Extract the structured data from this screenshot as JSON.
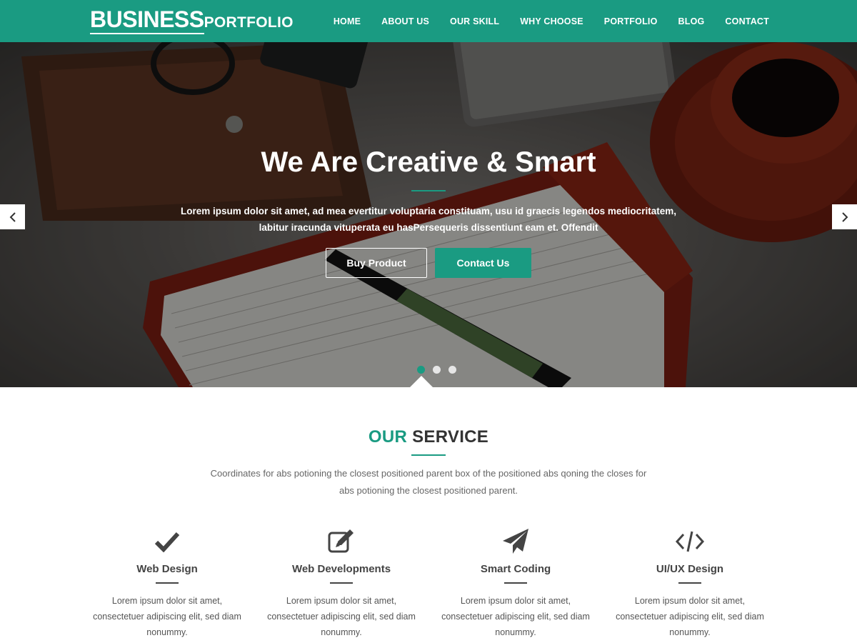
{
  "brand": {
    "main": "BUSINESS",
    "sub": "PORTFOLIO"
  },
  "nav": {
    "items": [
      "HOME",
      "ABOUT US",
      "OUR SKILL",
      "WHY CHOOSE",
      "PORTFOLIO",
      "BLOG",
      "CONTACT"
    ]
  },
  "hero": {
    "title": "We Are Creative & Smart",
    "text": "Lorem ipsum dolor sit amet, ad mea evertitur voluptaria constituam, usu id graecis legendos mediocritatem, labitur iracunda vituperata eu hasPersequeris dissentiunt eam et. Offendit",
    "buy_label": "Buy Product",
    "contact_label": "Contact Us",
    "slides": 3,
    "active_slide": 1
  },
  "services": {
    "title_accent": "OUR",
    "title_rest": "SERVICE",
    "intro": "Coordinates for abs potioning the closest positioned parent box of the positioned abs qoning the closes for abs potioning the closest positioned parent.",
    "items": [
      {
        "icon": "check-icon",
        "title": "Web Design",
        "text": "Lorem ipsum dolor sit amet, consectetuer adipiscing elit, sed diam nonummy."
      },
      {
        "icon": "edit-icon",
        "title": "Web Developments",
        "text": "Lorem ipsum dolor sit amet, consectetuer adipiscing elit, sed diam nonummy."
      },
      {
        "icon": "paper-plane-icon",
        "title": "Smart Coding",
        "text": "Lorem ipsum dolor sit amet, consectetuer adipiscing elit, sed diam nonummy."
      },
      {
        "icon": "code-icon",
        "title": "UI/UX Design",
        "text": "Lorem ipsum dolor sit amet, consectetuer adipiscing elit, sed diam nonummy."
      }
    ]
  },
  "colors": {
    "accent": "#1a9b82",
    "text_dark": "#333333",
    "text_muted": "#666666"
  }
}
